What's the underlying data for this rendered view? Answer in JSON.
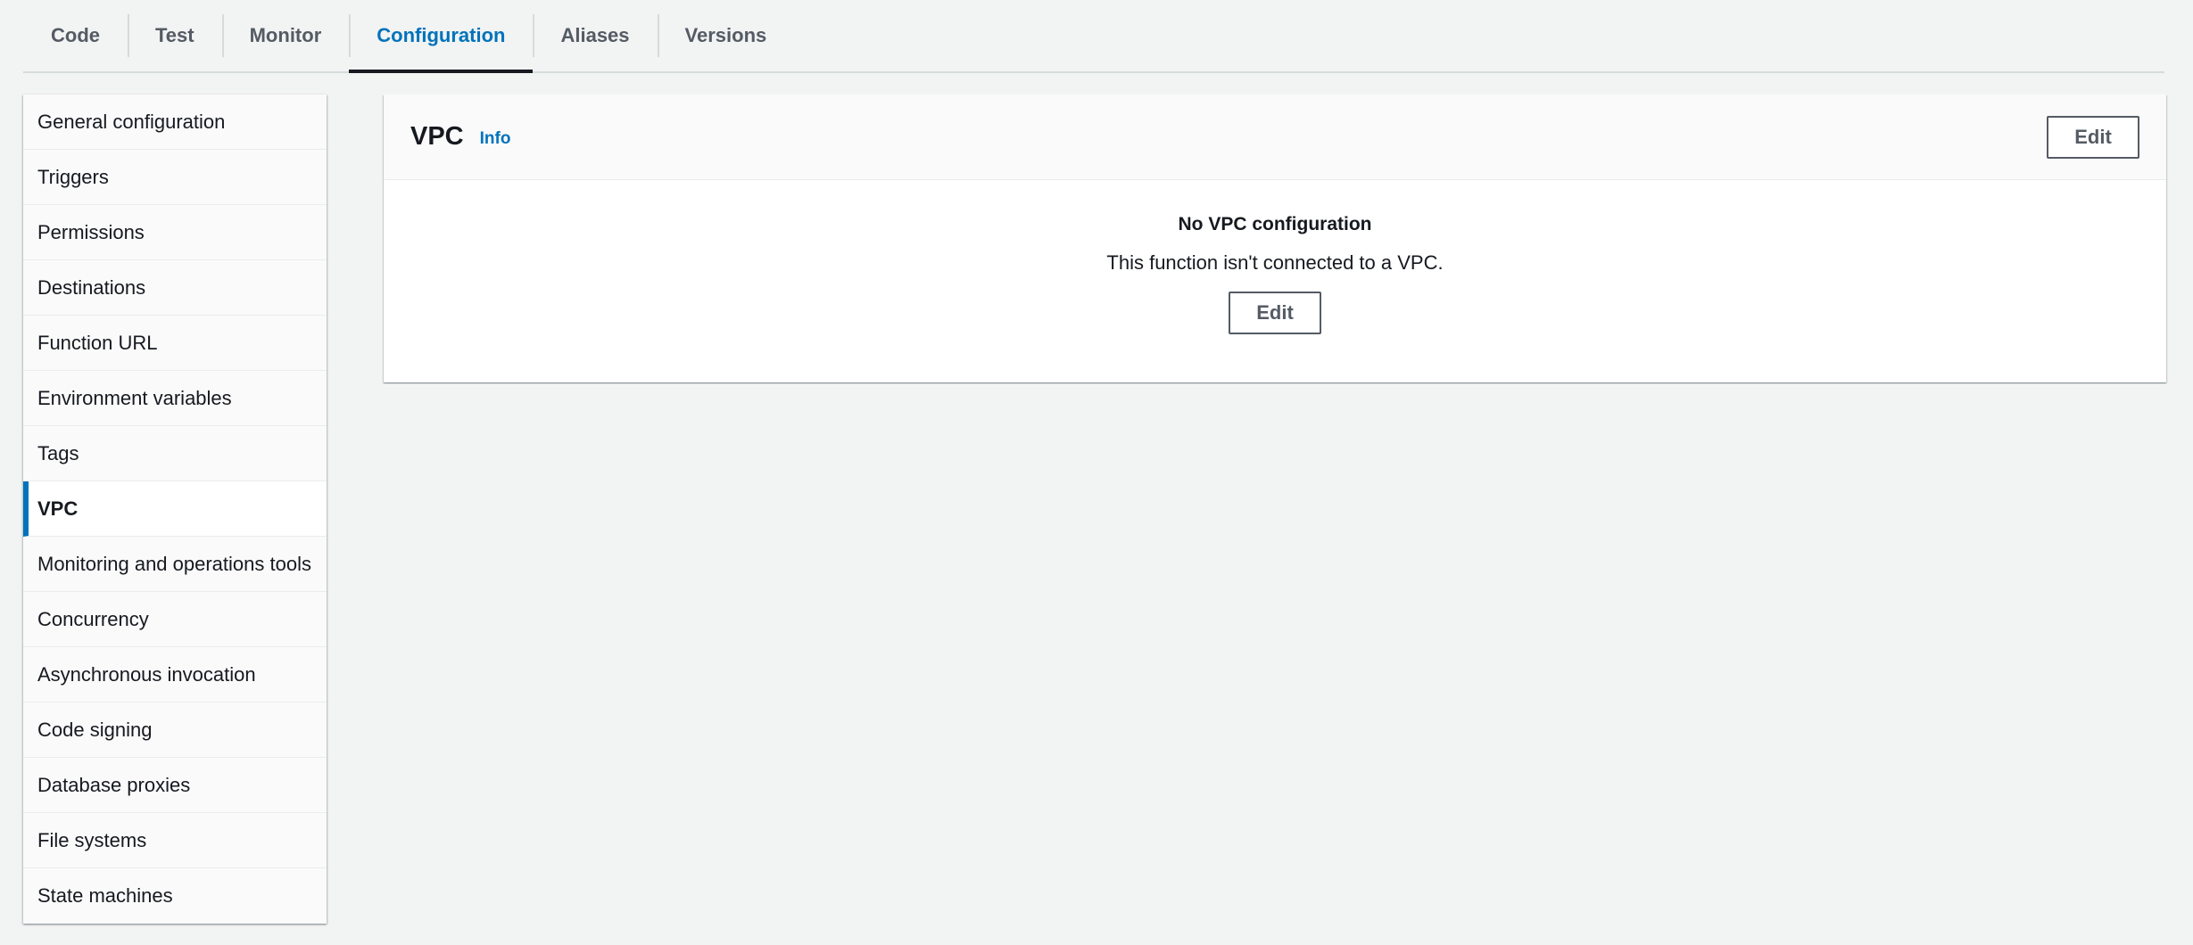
{
  "tabs": [
    {
      "label": "Code"
    },
    {
      "label": "Test"
    },
    {
      "label": "Monitor"
    },
    {
      "label": "Configuration"
    },
    {
      "label": "Aliases"
    },
    {
      "label": "Versions"
    }
  ],
  "active_tab": "Configuration",
  "sidebar": {
    "items": [
      {
        "label": "General configuration"
      },
      {
        "label": "Triggers"
      },
      {
        "label": "Permissions"
      },
      {
        "label": "Destinations"
      },
      {
        "label": "Function URL"
      },
      {
        "label": "Environment variables"
      },
      {
        "label": "Tags"
      },
      {
        "label": "VPC"
      },
      {
        "label": "Monitoring and operations tools"
      },
      {
        "label": "Concurrency"
      },
      {
        "label": "Asynchronous invocation"
      },
      {
        "label": "Code signing"
      },
      {
        "label": "Database proxies"
      },
      {
        "label": "File systems"
      },
      {
        "label": "State machines"
      }
    ],
    "active_item": "VPC"
  },
  "panel": {
    "title": "VPC",
    "info_label": "Info",
    "edit_label": "Edit",
    "empty_title": "No VPC configuration",
    "empty_description": "This function isn't connected to a VPC.",
    "body_edit_label": "Edit"
  },
  "colors": {
    "accent": "#0073bb",
    "background": "#f2f3f3",
    "text": "#16191f",
    "muted": "#545b64"
  }
}
